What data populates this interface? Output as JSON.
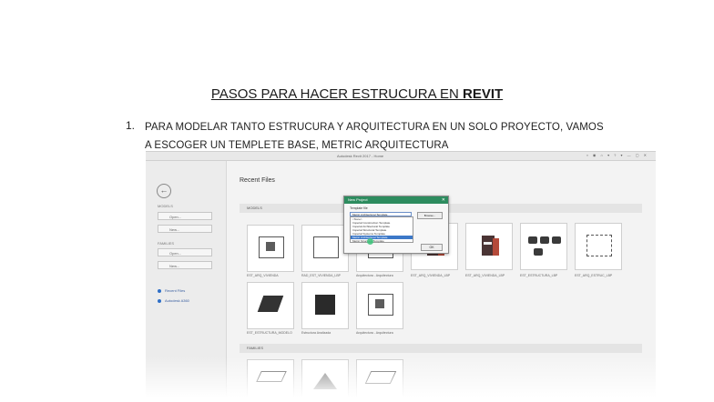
{
  "slide": {
    "title_prefix": "PASOS PARA HACER ESTRUCURA EN ",
    "title_brand": "REVIT",
    "step_number": "1.",
    "step_line1": "PARA MODELAR TANTO ESTRUCURA Y ARQUITECTURA EN UN SOLO PROYECTO, VAMOS",
    "step_line2": "A ESCOGER UN TEMPLETE BASE, METRIC ARQUITECTURA"
  },
  "screenshot": {
    "window_title": "Autodesk Revit 2017 - Home",
    "toolbar_text": "▪ ◉ ⌂ ▾ ? ▾  — ▢ ✕",
    "sidebar": {
      "back_icon": "back-arrow-icon",
      "projects_header": "MODELS",
      "projects_open": "Open...",
      "projects_new": "New...",
      "families_header": "FAMILIES",
      "families_open": "Open...",
      "families_new": "New...",
      "recent_files_link": "Recent Files",
      "autodesk_link": "Autodesk A360"
    },
    "main": {
      "recent_title": "Recent Files",
      "models_section": "MODELS",
      "families_section": "FAMILIES",
      "model_labels": [
        "EST_ARQ_VIVIENDA",
        "RAD_EST_VIVIENDA_LBP",
        "Arquitectura - Arquitectura",
        "EST_ARQ_VIVIENDA_LBP",
        "EST_ARQ_VIVIENDA_LBP",
        "EST_ESTRUCTURA_LBP",
        "EST_ARQ_ESTRUC_LBP"
      ],
      "model_labels_row2": [
        "EST_ESTRUCTURA_MODELO",
        "Estructura Analizada",
        "Arquitectura - Arquitectura"
      ]
    },
    "dialog": {
      "title": "New Project",
      "close": "✕",
      "template_label": "Template file",
      "selected_template": "Metric Architectural Template",
      "browse": "Browse...",
      "list_items": [
        "<None>",
        "Imperial Construction Template",
        "Imperial Architectural Template",
        "Imperial Structural Template",
        "Imperial Systems Template",
        "Metric Architectural Template",
        "Metric Structural Template"
      ],
      "ok": "OK"
    }
  }
}
